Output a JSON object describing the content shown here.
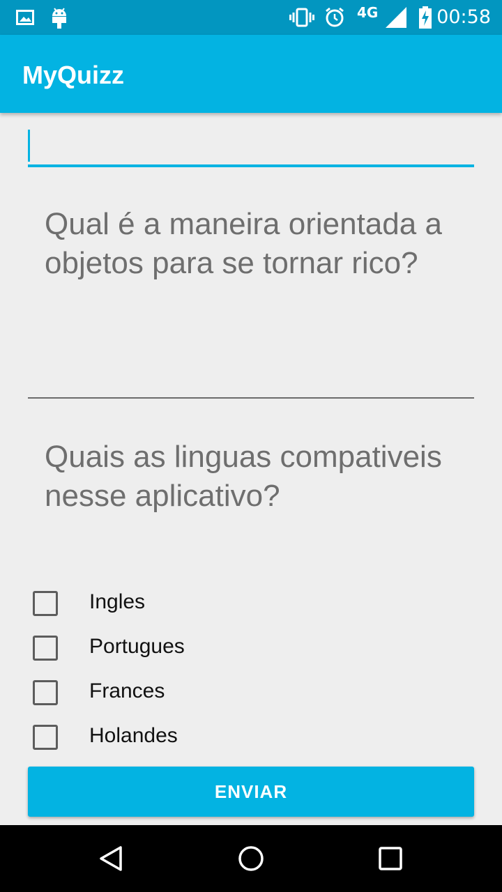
{
  "status_bar": {
    "time": "00:58",
    "network": "4G",
    "icons": [
      "gallery-icon",
      "android-icon",
      "vibrate-icon",
      "alarm-icon",
      "signal-icon",
      "battery-charging-icon"
    ]
  },
  "app_bar": {
    "title": "MyQuizz"
  },
  "answer_field": {
    "value": "",
    "placeholder": ""
  },
  "questions": [
    {
      "text": "Qual é a maneira orientada a objetos para se tornar rico?"
    },
    {
      "text": "Quais as linguas compativeis nesse aplicativo?"
    }
  ],
  "options": [
    {
      "label": "Ingles",
      "checked": false
    },
    {
      "label": "Portugues",
      "checked": false
    },
    {
      "label": "Frances",
      "checked": false
    },
    {
      "label": "Holandes",
      "checked": false
    }
  ],
  "submit_label": "ENVIAR",
  "nav": {
    "icons": [
      "back-icon",
      "home-icon",
      "recents-icon"
    ]
  },
  "colors": {
    "primary": "#03b3e2",
    "primary_dark": "#0296c0",
    "background": "#eeeeee"
  }
}
